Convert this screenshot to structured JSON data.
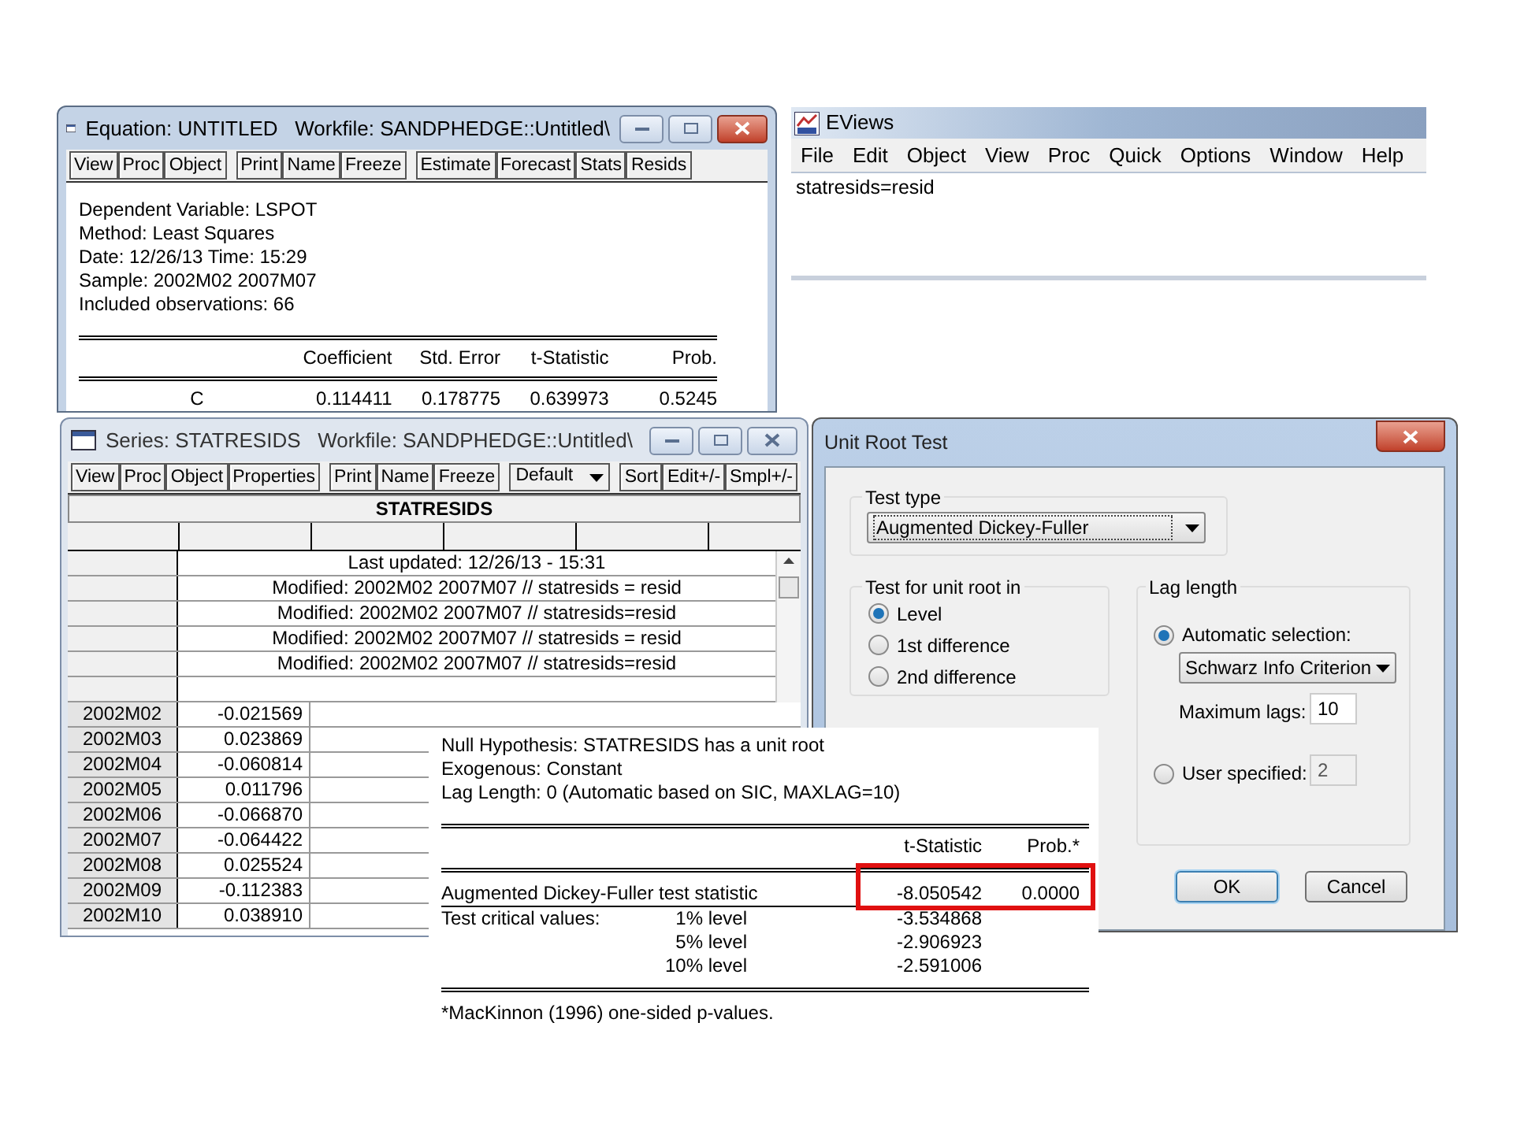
{
  "equation_window": {
    "title": "Equation: UNTITLED   Workfile: SANDPHEDGE::Untitled\\",
    "toolbar": [
      [
        "View",
        "Proc",
        "Object"
      ],
      [
        "Print",
        "Name",
        "Freeze"
      ],
      [
        "Estimate",
        "Forecast",
        "Stats",
        "Resids"
      ]
    ],
    "header_lines": [
      "Dependent Variable: LSPOT",
      "Method: Least Squares",
      "Date: 12/26/13   Time: 15:29",
      "Sample: 2002M02 2007M07",
      "Included observations: 66"
    ],
    "columns": [
      "Coefficient",
      "Std. Error",
      "t-Statistic",
      "Prob."
    ],
    "rows": [
      {
        "variable": "C",
        "values": [
          "0.114411",
          "0.178775",
          "0.639973",
          "0.5245"
        ]
      }
    ]
  },
  "eviews_window": {
    "title": "EViews",
    "menu": [
      "File",
      "Edit",
      "Object",
      "View",
      "Proc",
      "Quick",
      "Options",
      "Window",
      "Help"
    ],
    "command": "statresids=resid"
  },
  "series_window": {
    "title": "Series: STATRESIDS   Workfile: SANDPHEDGE::Untitled\\",
    "toolbar": [
      [
        "View",
        "Proc",
        "Object",
        "Properties"
      ],
      [
        "Print",
        "Name",
        "Freeze"
      ]
    ],
    "view_select": "Default",
    "toolbar_right": [
      "Sort",
      "Edit+/-",
      "Smpl+/-"
    ],
    "header": "STATRESIDS",
    "info_lines": [
      "Last updated: 12/26/13 - 15:31",
      "Modified: 2002M02 2007M07 // statresids = resid",
      "Modified: 2002M02 2007M07 // statresids=resid",
      "Modified: 2002M02 2007M07 // statresids = resid",
      "Modified: 2002M02 2007M07 // statresids=resid"
    ],
    "rows": [
      {
        "obs": "2002M02",
        "value": "-0.021569"
      },
      {
        "obs": "2002M03",
        "value": "0.023869"
      },
      {
        "obs": "2002M04",
        "value": "-0.060814"
      },
      {
        "obs": "2002M05",
        "value": "0.011796"
      },
      {
        "obs": "2002M06",
        "value": "-0.066870"
      },
      {
        "obs": "2002M07",
        "value": "-0.064422"
      },
      {
        "obs": "2002M08",
        "value": "0.025524"
      },
      {
        "obs": "2002M09",
        "value": "-0.112383"
      },
      {
        "obs": "2002M10",
        "value": "0.038910"
      }
    ]
  },
  "unit_root_dialog": {
    "title": "Unit Root Test",
    "test_type": {
      "label": "Test type",
      "value": "Augmented Dickey-Fuller"
    },
    "test_for": {
      "label": "Test for unit root in",
      "options": [
        {
          "label": "Level",
          "selected": true
        },
        {
          "label": "1st difference",
          "selected": false
        },
        {
          "label": "2nd difference",
          "selected": false
        }
      ]
    },
    "lag_length": {
      "label": "Lag length",
      "automatic": {
        "label": "Automatic selection:",
        "selected": true,
        "criterion": "Schwarz Info Criterion"
      },
      "max_lags": {
        "label": "Maximum lags:",
        "value": "10"
      },
      "user_specified": {
        "label": "User specified:",
        "selected": false,
        "value": "2",
        "disabled": true
      }
    },
    "buttons": [
      "OK",
      "Cancel"
    ]
  },
  "test_output": {
    "header_lines": [
      "Null Hypothesis: STATRESIDS has a unit root",
      "Exogenous: Constant",
      "Lag Length: 0 (Automatic based on SIC, MAXLAG=10)"
    ],
    "columns": [
      "t-Statistic",
      "Prob.*"
    ],
    "statistic": {
      "label": "Augmented Dickey-Fuller test statistic",
      "t": "-8.050542",
      "prob": "0.0000",
      "highlighted": true
    },
    "critical_label": "Test critical values:",
    "critical": [
      {
        "level": "1% level",
        "value": "-3.534868"
      },
      {
        "level": "5% level",
        "value": "-2.906923"
      },
      {
        "level": "10% level",
        "value": "-2.591006"
      }
    ],
    "footnote": "*MacKinnon (1996) one-sided p-values."
  }
}
